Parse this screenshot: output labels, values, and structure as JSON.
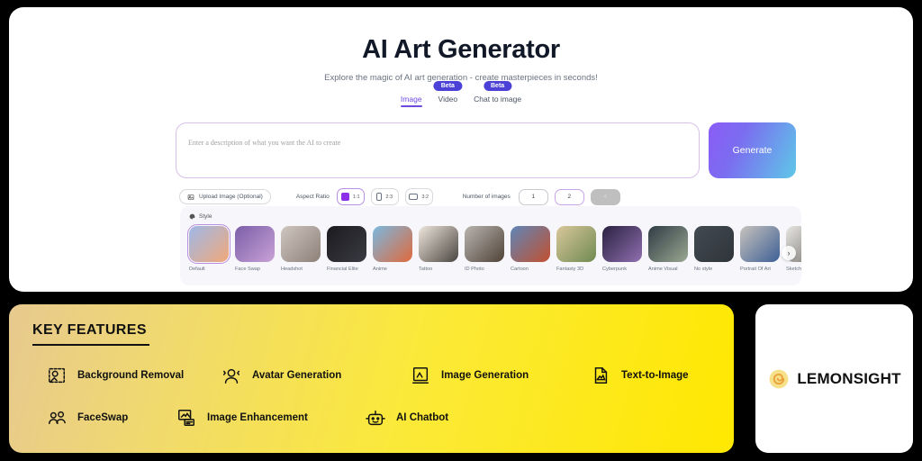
{
  "hero": {
    "title": "AI Art Generator",
    "subtitle": "Explore the magic of AI art generation - create masterpieces in seconds!"
  },
  "tabs": [
    {
      "label": "Image",
      "active": true,
      "badge": ""
    },
    {
      "label": "Video",
      "active": false,
      "badge": "Beta"
    },
    {
      "label": "Chat to image",
      "active": false,
      "badge": "Beta"
    }
  ],
  "prompt": {
    "value": "",
    "placeholder": "Enter a description of what you want the AI to create",
    "generate_label": "Generate"
  },
  "controls": {
    "upload_label": "Upload Image (Optional)",
    "aspect_ratio_label": "Aspect Ratio",
    "aspect_ratios": [
      {
        "label": "1:1",
        "selected": true
      },
      {
        "label": "2:3",
        "selected": false
      },
      {
        "label": "3:2",
        "selected": false
      }
    ],
    "number_of_images_label": "Number of images",
    "number_options": [
      {
        "label": "1",
        "selected": false,
        "disabled": false
      },
      {
        "label": "2",
        "selected": true,
        "disabled": false
      },
      {
        "label": "4",
        "selected": false,
        "disabled": true
      }
    ]
  },
  "style": {
    "label": "Style",
    "next_glyph": "›",
    "items": [
      {
        "name": "Default",
        "selected": true,
        "c1": "#9fb8e8",
        "c2": "#f0a878"
      },
      {
        "name": "Face Swap",
        "selected": false,
        "c1": "#7b5ea8",
        "c2": "#c9a2d6"
      },
      {
        "name": "Headshot",
        "selected": false,
        "c1": "#cfc6c0",
        "c2": "#8d8079"
      },
      {
        "name": "Financial Elite",
        "selected": false,
        "c1": "#1b1b1f",
        "c2": "#3a3a42"
      },
      {
        "name": "Anime",
        "selected": false,
        "c1": "#7ab8e0",
        "c2": "#e0693c"
      },
      {
        "name": "Tattoo",
        "selected": false,
        "c1": "#efe7dd",
        "c2": "#4a4540"
      },
      {
        "name": "ID Photo",
        "selected": false,
        "c1": "#b9b4b0",
        "c2": "#504338"
      },
      {
        "name": "Cartoon",
        "selected": false,
        "c1": "#5f86b8",
        "c2": "#c2502f"
      },
      {
        "name": "Fantasty 3D",
        "selected": false,
        "c1": "#d9c79a",
        "c2": "#6f8a52"
      },
      {
        "name": "Cyberpunk",
        "selected": false,
        "c1": "#2a2140",
        "c2": "#8f6fb0"
      },
      {
        "name": "Anime Visual",
        "selected": false,
        "c1": "#2f3b44",
        "c2": "#9aa892"
      },
      {
        "name": "No style",
        "selected": false,
        "c1": "#434a52",
        "c2": "#2e343a"
      },
      {
        "name": "Portrait Of Art",
        "selected": false,
        "c1": "#c8c3bd",
        "c2": "#3d5f95"
      },
      {
        "name": "Sketch",
        "selected": false,
        "c1": "#e8e6e3",
        "c2": "#6f6c68"
      }
    ]
  },
  "features": {
    "title": "KEY FEATURES",
    "rows": [
      [
        {
          "label": "Background Removal",
          "icon": "background-removal-icon"
        },
        {
          "label": "Avatar Generation",
          "icon": "avatar-generation-icon"
        },
        {
          "label": "Image Generation",
          "icon": "image-generation-icon"
        },
        {
          "label": "Text-to-Image",
          "icon": "text-to-image-icon"
        }
      ],
      [
        {
          "label": "FaceSwap",
          "icon": "faceswap-icon"
        },
        {
          "label": "Image Enhancement",
          "icon": "image-enhancement-icon"
        },
        {
          "label": "AI Chatbot",
          "icon": "ai-chatbot-icon"
        }
      ]
    ]
  },
  "brand": {
    "name": "LEMONSIGHT",
    "logo_color": "#f4d03f"
  },
  "colors": {
    "accent_purple": "#6d4ae0",
    "badge_blue": "#4b41d6",
    "feature_yellow": "#ffe800",
    "page_background": "#000000"
  }
}
